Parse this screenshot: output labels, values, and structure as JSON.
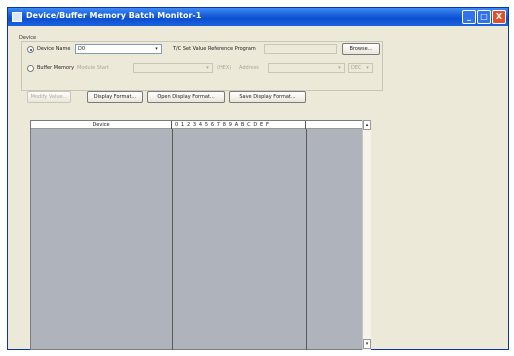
{
  "window": {
    "title": "Device/Buffer Memory Batch Monitor-1",
    "controls": {
      "minimize": "_",
      "maximize": "□",
      "close": "X"
    }
  },
  "device_group": {
    "label": "Device",
    "device_name_label": "Device Name",
    "device_name_value": "D0",
    "tc_label": "T/C Set Value Reference Program",
    "browse_label": "Browse...",
    "buffer_memory_label": "Buffer Memory",
    "module_start_label": "Module Start",
    "hex_label": "(HEX)",
    "address_label": "Address",
    "dec_value": "DEC"
  },
  "toolbar": {
    "modify_value": "Modify Value...",
    "display_format": "Display Format...",
    "open_display_format": "Open Display Format...",
    "save_display_format": "Save Display Format..."
  },
  "monitor": {
    "col_device": "Device",
    "col_bits": "0 1 2 3 4 5 6 7 8 9 A B C D E F",
    "col_value": ""
  },
  "scroll": {
    "up": "▴",
    "down": "▾"
  }
}
